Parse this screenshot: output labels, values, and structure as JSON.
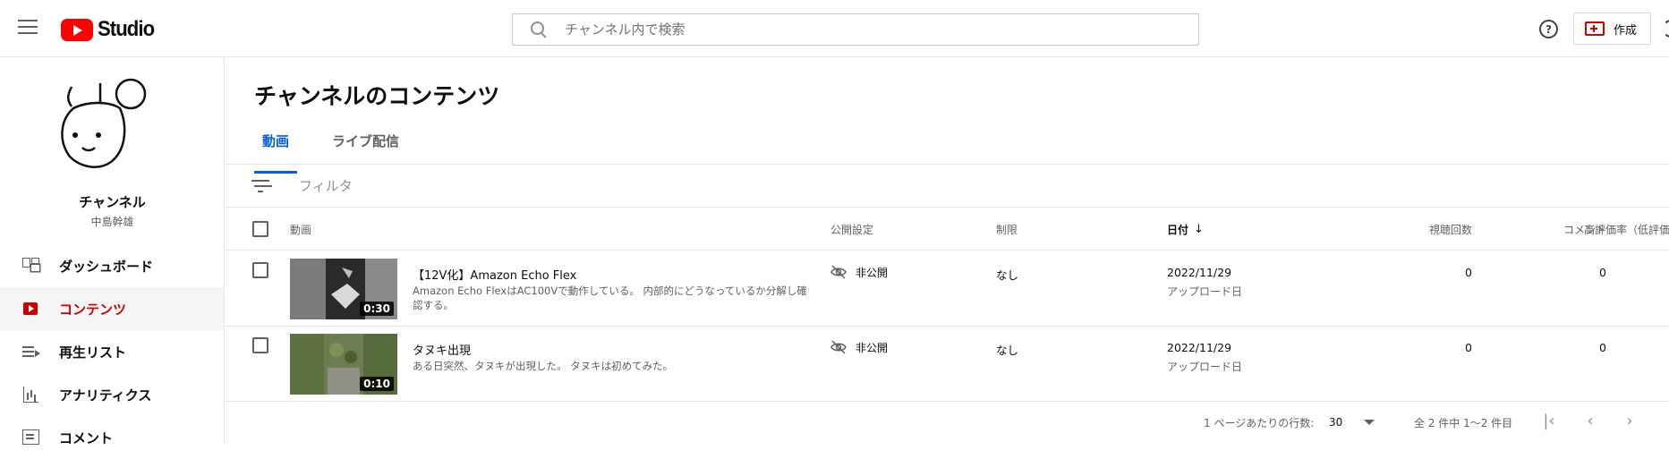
{
  "header": {
    "logo_text": "Studio",
    "search_placeholder": "チャンネル内で検索",
    "help_glyph": "?",
    "create_label": "作成"
  },
  "sidebar": {
    "channel_name": "チャンネル",
    "channel_handle": "中島幹雄",
    "items": [
      {
        "label": "ダッシュボード",
        "icon": "dashboard-icon",
        "active": false
      },
      {
        "label": "コンテンツ",
        "icon": "content-icon",
        "active": true
      },
      {
        "label": "再生リスト",
        "icon": "playlist-icon",
        "active": false
      },
      {
        "label": "アナリティクス",
        "icon": "analytics-icon",
        "active": false
      },
      {
        "label": "コメント",
        "icon": "comment-icon",
        "active": false
      }
    ]
  },
  "main": {
    "title": "チャンネルのコンテンツ",
    "tabs": [
      {
        "label": "動画",
        "active": true
      },
      {
        "label": "ライブ配信",
        "active": false
      }
    ],
    "filter_label": "フィルタ",
    "columns": {
      "video": "動画",
      "visibility": "公開設定",
      "restrictions": "制限",
      "date": "日付",
      "date_sort": "↓",
      "views": "視聴回数",
      "comments": "コメント",
      "likes": "高評価率（低評価"
    },
    "rows": [
      {
        "title": "【12V化】Amazon Echo Flex",
        "description": "Amazon Echo FlexはAC100Vで動作している。 内部的にどうなっているか分解し確認する。",
        "duration": "0:30",
        "visibility": "非公開",
        "restrictions": "なし",
        "date": "2022/11/29",
        "date_type": "アップロード日",
        "views": "0",
        "comments": "0"
      },
      {
        "title": "タヌキ出現",
        "description": "ある日突然、タヌキが出現した。 タヌキは初めてみた。",
        "duration": "0:10",
        "visibility": "非公開",
        "restrictions": "なし",
        "date": "2022/11/29",
        "date_type": "アップロード日",
        "views": "0",
        "comments": "0"
      }
    ],
    "pagination": {
      "rows_per_page_label": "1 ページあたりの行数:",
      "rows_per_page_value": "30",
      "range_text": "全 2 件中 1〜2 件目",
      "first_glyph": "|‹",
      "prev_glyph": "‹",
      "next_glyph": "›"
    }
  },
  "colors": {
    "brand_red": "#ff0000",
    "active_red": "#cc0000",
    "tab_blue": "#065fd4"
  }
}
